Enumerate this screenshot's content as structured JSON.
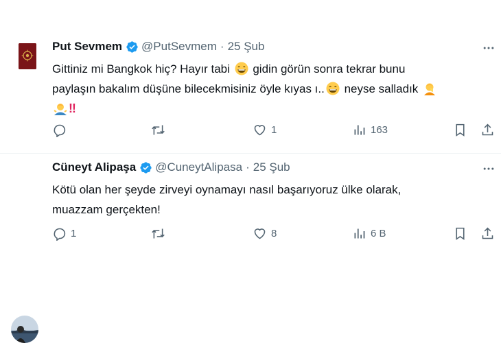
{
  "tweets": [
    {
      "name": "Put Sevmem",
      "handle": "@PutSevmem",
      "separator": "·",
      "date": "25 Şub",
      "lines": [
        {
          "segments": [
            "Gittiniz mi Bangkok hiç? Hayır tabi ",
            " gidin görün sonra tekrar bunu"
          ]
        },
        {
          "segments": [
            "paylaşın bakalım düşüne bilecekmisiniz öyle kıyas ı..",
            " neyse salladık "
          ]
        },
        {
          "segments": [
            "‼"
          ]
        }
      ],
      "replies": "",
      "retweets": "",
      "likes": "1",
      "views": "163"
    },
    {
      "name": "Cüneyt Alipaşa",
      "handle": "@CuneytAlipasa",
      "separator": "·",
      "date": "25 Şub",
      "lines": [
        {
          "segments": [
            "Kötü olan her şeyde zirveyi oynamayı nasıl başarıyoruz ülke olarak,"
          ]
        },
        {
          "segments": [
            "muazzam gerçekten!"
          ]
        }
      ],
      "replies": "1",
      "retweets": "",
      "likes": "8",
      "views": "6 B"
    }
  ],
  "colors": {
    "text": "#0f1419",
    "secondary": "#536471",
    "verified": "#1d9bf0",
    "divider": "#eff3f4",
    "alert": "#e0245e"
  },
  "icons": [
    "verified-badge-icon",
    "more-icon",
    "reply-icon",
    "retweet-icon",
    "like-icon",
    "views-icon",
    "bookmark-icon",
    "share-icon",
    "grinning-emoji-icon",
    "person-facepalming-icon",
    "person-shrugging-icon"
  ]
}
